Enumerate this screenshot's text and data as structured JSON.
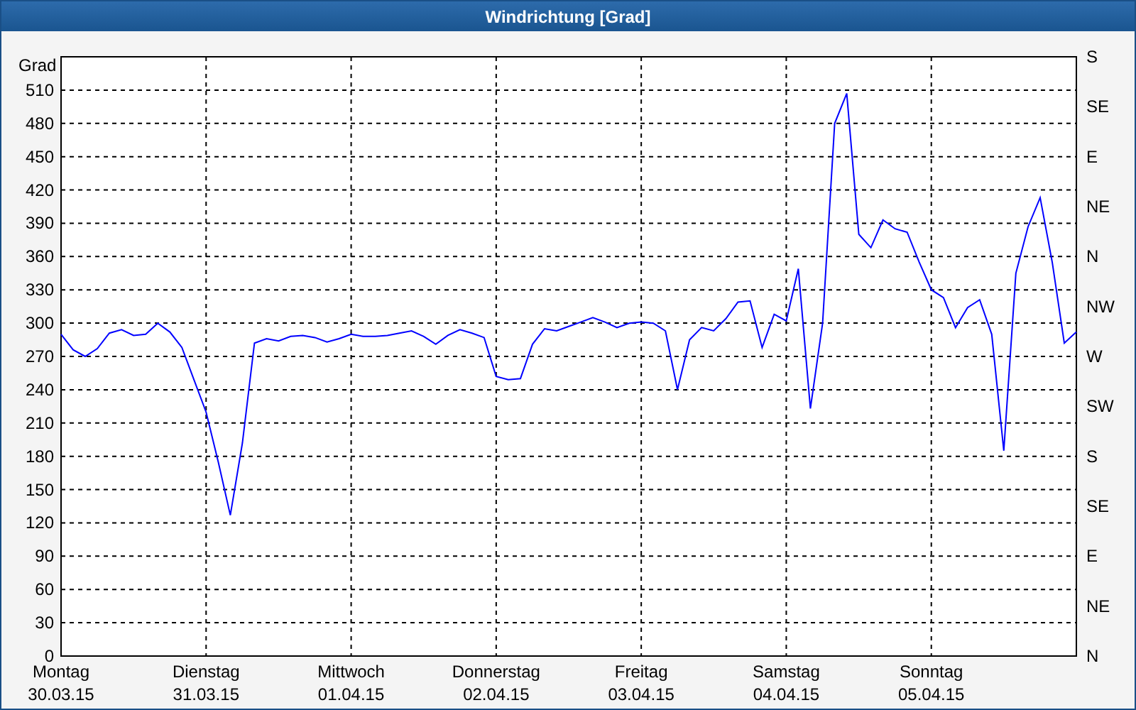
{
  "window": {
    "title": "Windrichtung [Grad]"
  },
  "chart": {
    "chart_data": {
      "type": "line",
      "grid": true,
      "ylabel": "Grad",
      "ylim": [
        0,
        540
      ],
      "categories": [
        "Montag\n30.03.15",
        null,
        null,
        null,
        null,
        null,
        null,
        null,
        null,
        null,
        null,
        null,
        "Dienstag\n31.03.15",
        null,
        null,
        null,
        null,
        null,
        null,
        null,
        null,
        null,
        null,
        null,
        "Mittwoch\n01.04.15",
        null,
        null,
        null,
        null,
        null,
        null,
        null,
        null,
        null,
        null,
        null,
        "Donnerstag\n02.04.15",
        null,
        null,
        null,
        null,
        null,
        null,
        null,
        null,
        null,
        null,
        null,
        "Freitag\n03.04.15",
        null,
        null,
        null,
        null,
        null,
        null,
        null,
        null,
        null,
        null,
        null,
        "Samstag\n04.04.15",
        null,
        null,
        null,
        null,
        null,
        null,
        null,
        null,
        null,
        null,
        null,
        "Sonntag\n05.04.15",
        null,
        null,
        null,
        null,
        null,
        null,
        null,
        null,
        null,
        null,
        null,
        null
      ],
      "series": [
        {
          "color": "#0000ff",
          "values": [
            290,
            276,
            270,
            277,
            291,
            294,
            289,
            290,
            300,
            292,
            278,
            249,
            220,
            175,
            127,
            192,
            282,
            286,
            284,
            288,
            289,
            287,
            283,
            286,
            290,
            288,
            288,
            289,
            291,
            293,
            288,
            281,
            289,
            294,
            291,
            287,
            252,
            249,
            250,
            281,
            295,
            293,
            297,
            301,
            305,
            301,
            296,
            300,
            301,
            300,
            293,
            240,
            285,
            296,
            293,
            304,
            319,
            320,
            278,
            308,
            302,
            349,
            223,
            300,
            480,
            507,
            380,
            368,
            393,
            385,
            382,
            355,
            330,
            323,
            296,
            314,
            321,
            290,
            185,
            345,
            387,
            413,
            355,
            282,
            292
          ]
        }
      ],
      "yticks": [
        0,
        30,
        60,
        90,
        120,
        150,
        180,
        210,
        240,
        270,
        300,
        330,
        360,
        390,
        420,
        450,
        480,
        510
      ]
    },
    "right_ticks": [
      "S",
      "SE",
      "E",
      "NE",
      "N",
      "NW",
      "W",
      "SW",
      "S",
      "SE",
      "E",
      "NE",
      "N"
    ]
  }
}
